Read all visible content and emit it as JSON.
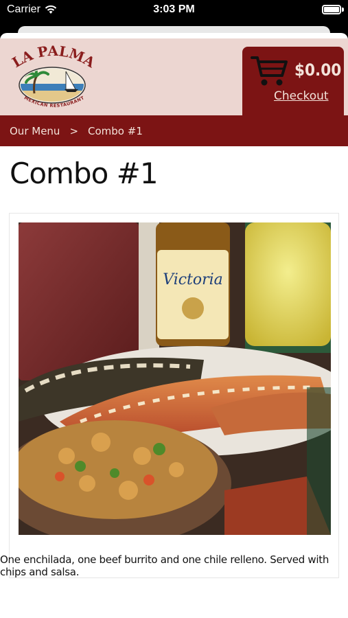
{
  "status_bar": {
    "carrier": "Carrier",
    "time": "3:03 PM"
  },
  "header": {
    "logo_text": "LA PALMA",
    "logo_subtext": "MEXICAN RESTAURANT",
    "cart_total": "$0.00",
    "checkout_label": "Checkout"
  },
  "breadcrumb": {
    "items": [
      "Our Menu",
      ">",
      "Combo #1"
    ]
  },
  "product": {
    "title": "Combo #1",
    "description": "One enchilada, one beef burrito and one chile relleno. Served with chips and salsa.",
    "bottle_label": "Victoria"
  },
  "colors": {
    "brand_red": "#7c1414",
    "header_bg": "#ecd6d1"
  }
}
